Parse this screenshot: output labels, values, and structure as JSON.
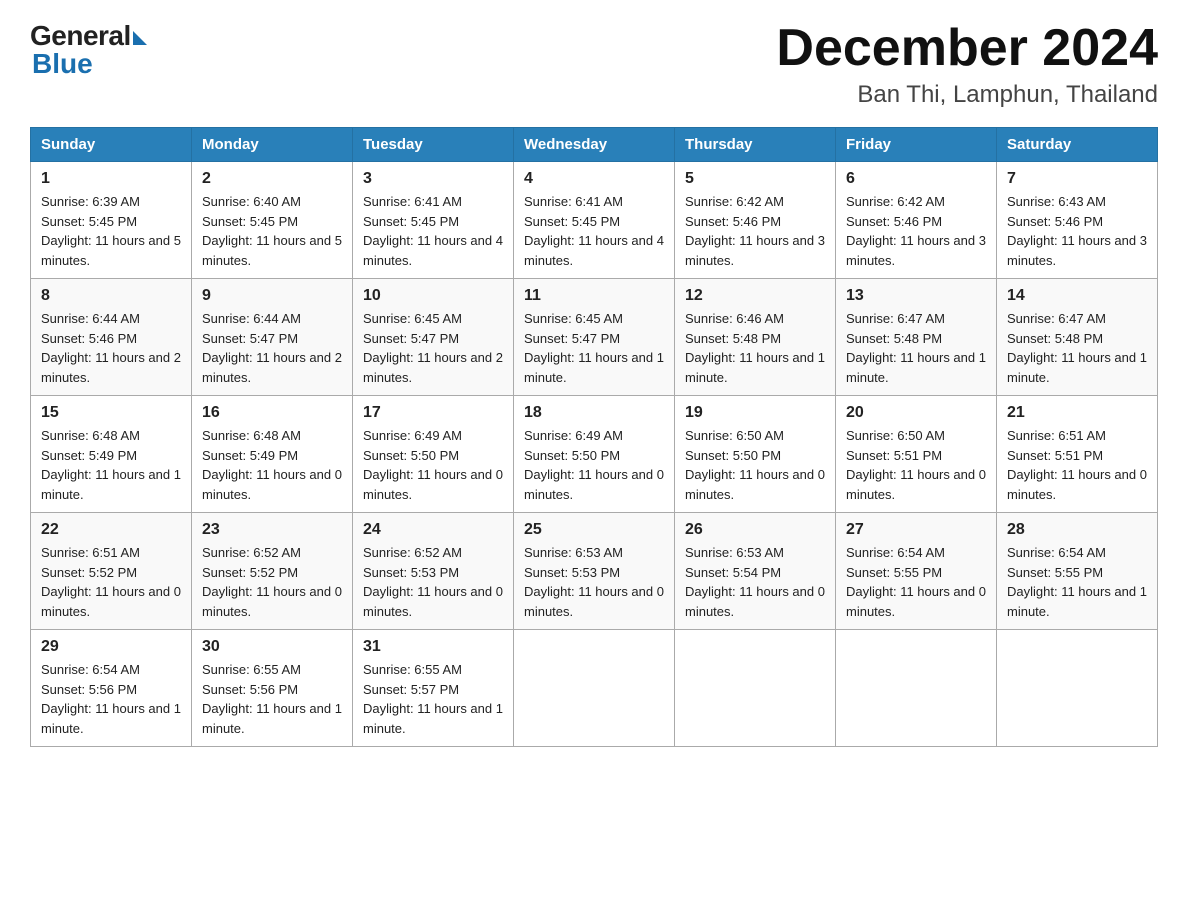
{
  "header": {
    "logo_general": "General",
    "logo_blue": "Blue",
    "month_title": "December 2024",
    "location": "Ban Thi, Lamphun, Thailand"
  },
  "weekdays": [
    "Sunday",
    "Monday",
    "Tuesday",
    "Wednesday",
    "Thursday",
    "Friday",
    "Saturday"
  ],
  "weeks": [
    [
      {
        "day": "1",
        "sunrise": "6:39 AM",
        "sunset": "5:45 PM",
        "daylight": "11 hours and 5 minutes."
      },
      {
        "day": "2",
        "sunrise": "6:40 AM",
        "sunset": "5:45 PM",
        "daylight": "11 hours and 5 minutes."
      },
      {
        "day": "3",
        "sunrise": "6:41 AM",
        "sunset": "5:45 PM",
        "daylight": "11 hours and 4 minutes."
      },
      {
        "day": "4",
        "sunrise": "6:41 AM",
        "sunset": "5:45 PM",
        "daylight": "11 hours and 4 minutes."
      },
      {
        "day": "5",
        "sunrise": "6:42 AM",
        "sunset": "5:46 PM",
        "daylight": "11 hours and 3 minutes."
      },
      {
        "day": "6",
        "sunrise": "6:42 AM",
        "sunset": "5:46 PM",
        "daylight": "11 hours and 3 minutes."
      },
      {
        "day": "7",
        "sunrise": "6:43 AM",
        "sunset": "5:46 PM",
        "daylight": "11 hours and 3 minutes."
      }
    ],
    [
      {
        "day": "8",
        "sunrise": "6:44 AM",
        "sunset": "5:46 PM",
        "daylight": "11 hours and 2 minutes."
      },
      {
        "day": "9",
        "sunrise": "6:44 AM",
        "sunset": "5:47 PM",
        "daylight": "11 hours and 2 minutes."
      },
      {
        "day": "10",
        "sunrise": "6:45 AM",
        "sunset": "5:47 PM",
        "daylight": "11 hours and 2 minutes."
      },
      {
        "day": "11",
        "sunrise": "6:45 AM",
        "sunset": "5:47 PM",
        "daylight": "11 hours and 1 minute."
      },
      {
        "day": "12",
        "sunrise": "6:46 AM",
        "sunset": "5:48 PM",
        "daylight": "11 hours and 1 minute."
      },
      {
        "day": "13",
        "sunrise": "6:47 AM",
        "sunset": "5:48 PM",
        "daylight": "11 hours and 1 minute."
      },
      {
        "day": "14",
        "sunrise": "6:47 AM",
        "sunset": "5:48 PM",
        "daylight": "11 hours and 1 minute."
      }
    ],
    [
      {
        "day": "15",
        "sunrise": "6:48 AM",
        "sunset": "5:49 PM",
        "daylight": "11 hours and 1 minute."
      },
      {
        "day": "16",
        "sunrise": "6:48 AM",
        "sunset": "5:49 PM",
        "daylight": "11 hours and 0 minutes."
      },
      {
        "day": "17",
        "sunrise": "6:49 AM",
        "sunset": "5:50 PM",
        "daylight": "11 hours and 0 minutes."
      },
      {
        "day": "18",
        "sunrise": "6:49 AM",
        "sunset": "5:50 PM",
        "daylight": "11 hours and 0 minutes."
      },
      {
        "day": "19",
        "sunrise": "6:50 AM",
        "sunset": "5:50 PM",
        "daylight": "11 hours and 0 minutes."
      },
      {
        "day": "20",
        "sunrise": "6:50 AM",
        "sunset": "5:51 PM",
        "daylight": "11 hours and 0 minutes."
      },
      {
        "day": "21",
        "sunrise": "6:51 AM",
        "sunset": "5:51 PM",
        "daylight": "11 hours and 0 minutes."
      }
    ],
    [
      {
        "day": "22",
        "sunrise": "6:51 AM",
        "sunset": "5:52 PM",
        "daylight": "11 hours and 0 minutes."
      },
      {
        "day": "23",
        "sunrise": "6:52 AM",
        "sunset": "5:52 PM",
        "daylight": "11 hours and 0 minutes."
      },
      {
        "day": "24",
        "sunrise": "6:52 AM",
        "sunset": "5:53 PM",
        "daylight": "11 hours and 0 minutes."
      },
      {
        "day": "25",
        "sunrise": "6:53 AM",
        "sunset": "5:53 PM",
        "daylight": "11 hours and 0 minutes."
      },
      {
        "day": "26",
        "sunrise": "6:53 AM",
        "sunset": "5:54 PM",
        "daylight": "11 hours and 0 minutes."
      },
      {
        "day": "27",
        "sunrise": "6:54 AM",
        "sunset": "5:55 PM",
        "daylight": "11 hours and 0 minutes."
      },
      {
        "day": "28",
        "sunrise": "6:54 AM",
        "sunset": "5:55 PM",
        "daylight": "11 hours and 1 minute."
      }
    ],
    [
      {
        "day": "29",
        "sunrise": "6:54 AM",
        "sunset": "5:56 PM",
        "daylight": "11 hours and 1 minute."
      },
      {
        "day": "30",
        "sunrise": "6:55 AM",
        "sunset": "5:56 PM",
        "daylight": "11 hours and 1 minute."
      },
      {
        "day": "31",
        "sunrise": "6:55 AM",
        "sunset": "5:57 PM",
        "daylight": "11 hours and 1 minute."
      },
      null,
      null,
      null,
      null
    ]
  ]
}
